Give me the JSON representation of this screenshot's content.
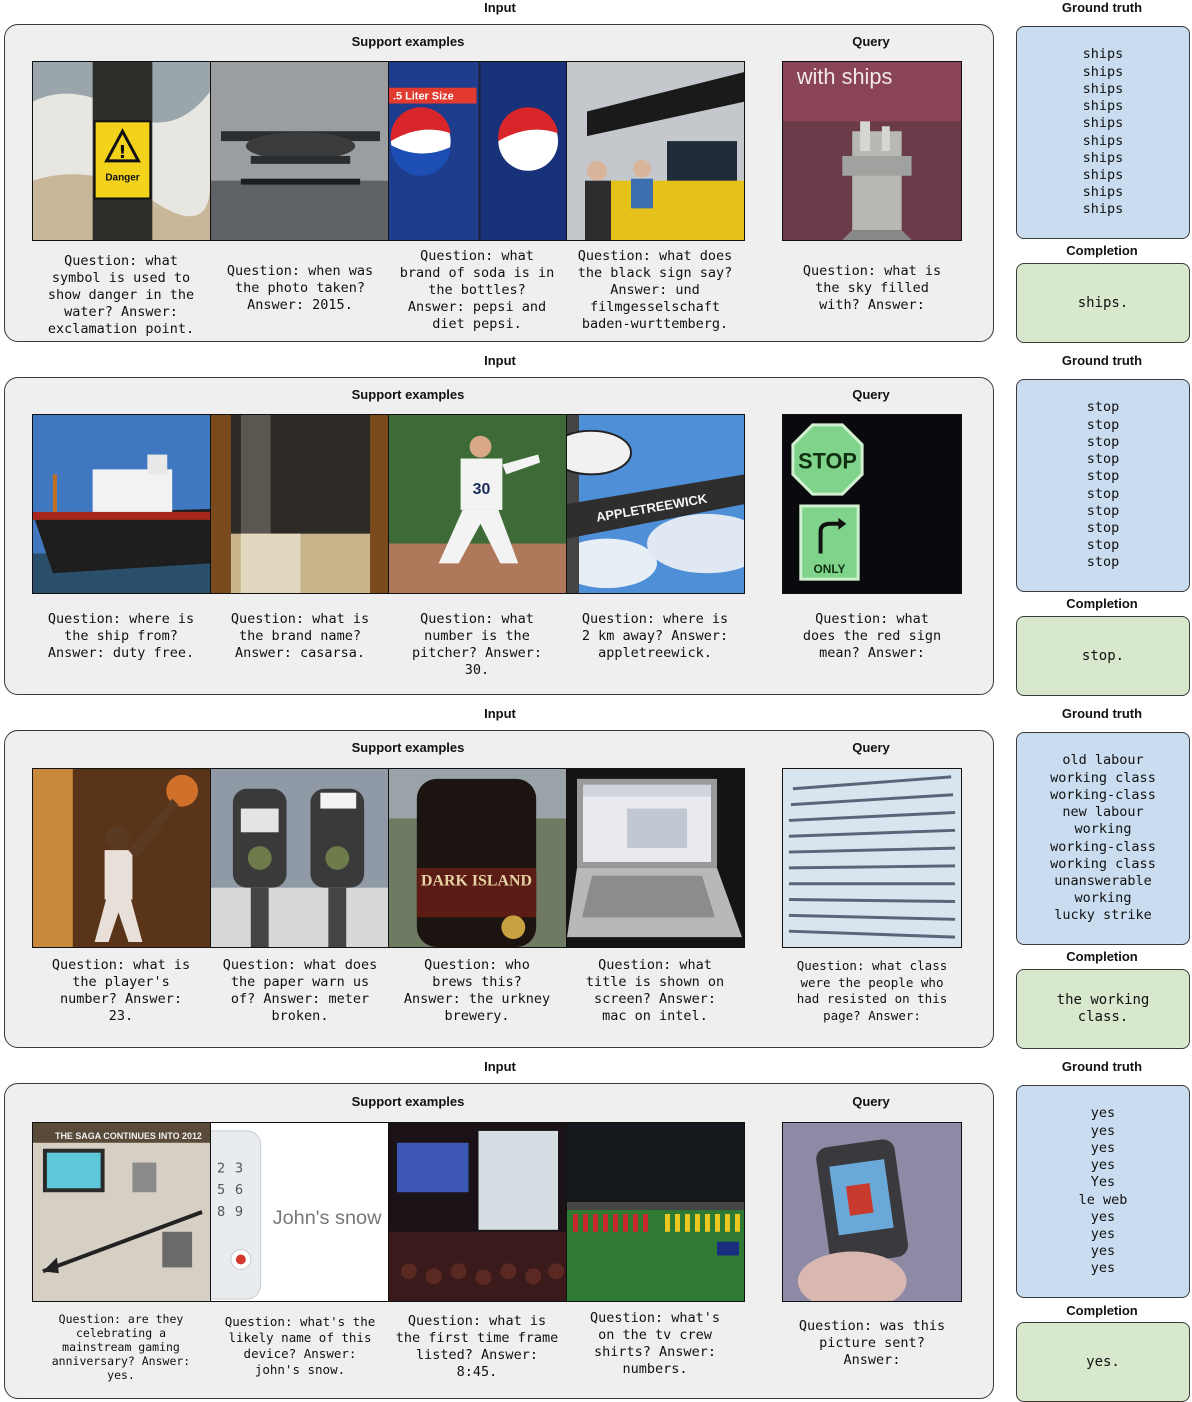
{
  "labels": {
    "input": "Input",
    "support": "Support examples",
    "query": "Query",
    "ground_truth": "Ground truth",
    "completion": "Completion"
  },
  "rows": [
    {
      "support": [
        {
          "question": "Question: what\nsymbol is used to\nshow danger in the\nwater? Answer:\nexclamation point.",
          "image": "danger-sign-pole-beach",
          "sign_text": "Danger"
        },
        {
          "question": "Question: when was\nthe photo taken?\nAnswer: 2015.",
          "image": "vintage-seaplane"
        },
        {
          "question": "Question: what\nbrand of soda is in\nthe bottles?\nAnswer: pepsi and\ndiet pepsi.",
          "image": "pepsi-bottles",
          "sign_text": ".5 Liter Size"
        },
        {
          "question": "Question: what does\nthe black sign say?\nAnswer: und\nfilmgesselschaft\nbaden-wurttemberg.",
          "image": "exhibition-stand"
        }
      ],
      "query": {
        "question": "Question: what is\nthe sky filled\nwith? Answer:",
        "image": "book-cover-ships",
        "cover_text": "with ships"
      },
      "ground_truth": [
        "ships",
        "ships",
        "ships",
        "ships",
        "ships",
        "ships",
        "ships",
        "ships",
        "ships",
        "ships"
      ],
      "completion": "ships."
    },
    {
      "support": [
        {
          "question": "Question: where is\nthe ship from?\nAnswer: duty free.",
          "image": "cargo-ship"
        },
        {
          "question": "Question: what is\nthe brand name?\nAnswer: casarsa.",
          "image": "wine-bottle"
        },
        {
          "question": "Question: what\nnumber is the\npitcher? Answer:\n30.",
          "image": "baseball-pitcher",
          "jersey": "30"
        },
        {
          "question": "Question: where is\n2 km away? Answer:\nappletreewick.",
          "image": "road-sign",
          "sign_text": "APPLETREEWICK"
        }
      ],
      "query": {
        "question": "Question: what\ndoes the red sign\nmean? Answer:",
        "image": "stop-sign",
        "sign_text": "STOP",
        "sub_sign": "ONLY"
      },
      "ground_truth": [
        "stop",
        "stop",
        "stop",
        "stop",
        "stop",
        "stop",
        "stop",
        "stop",
        "stop",
        "stop"
      ],
      "completion": "stop."
    },
    {
      "support": [
        {
          "question": "Question: what is\nthe player's\nnumber? Answer:\n23.",
          "image": "basketball-player"
        },
        {
          "question": "Question: what does\nthe paper warn us\nof? Answer: meter\nbroken.",
          "image": "parking-meters"
        },
        {
          "question": "Question: who\nbrews this?\nAnswer: the urkney\nbrewery.",
          "image": "beer-bottle",
          "label_text": "DARK ISLAND"
        },
        {
          "question": "Question: what\ntitle is shown on\nscreen? Answer:\nmac on intel.",
          "image": "laptop"
        }
      ],
      "query": {
        "question": "Question: what class\nwere the people who\nhad resisted on this\npage? Answer:",
        "image": "book-page"
      },
      "ground_truth": [
        "old labour",
        "working class",
        "working-class",
        "new labour",
        "working",
        "working-class",
        "working class",
        "unanswerable",
        "working",
        "lucky strike"
      ],
      "completion": "the working\nclass."
    },
    {
      "support": [
        {
          "question": "Question: are they\ncelebrating a\nmainstream gaming\nanniversary? Answer:\nyes.",
          "image": "gaming-exhibit",
          "banner_text": "THE SAGA CONTINUES INTO 2012"
        },
        {
          "question": "Question: what's the\nlikely name of this\ndevice? Answer:\njohn's snow.",
          "image": "phone-device",
          "brand_text": "John's snow"
        },
        {
          "question": "Question: what is\nthe first time frame\nlisted? Answer:\n8:45.",
          "image": "conference-hall"
        },
        {
          "question": "Question: what's\non the tv crew\nshirts? Answer:\nnumbers.",
          "image": "soccer-stadium"
        }
      ],
      "query": {
        "question": "Question: was this\npicture sent?\nAnswer:",
        "image": "flip-phone-hand"
      },
      "ground_truth": [
        "yes",
        "yes",
        "yes",
        "yes",
        "Yes",
        "le web",
        "yes",
        "yes",
        "yes",
        "yes"
      ],
      "completion": "yes."
    }
  ],
  "colors": {
    "panel_bg": "#efefef",
    "ground_truth_bg": "#c9dcf0",
    "completion_bg": "#d8e8cc"
  }
}
